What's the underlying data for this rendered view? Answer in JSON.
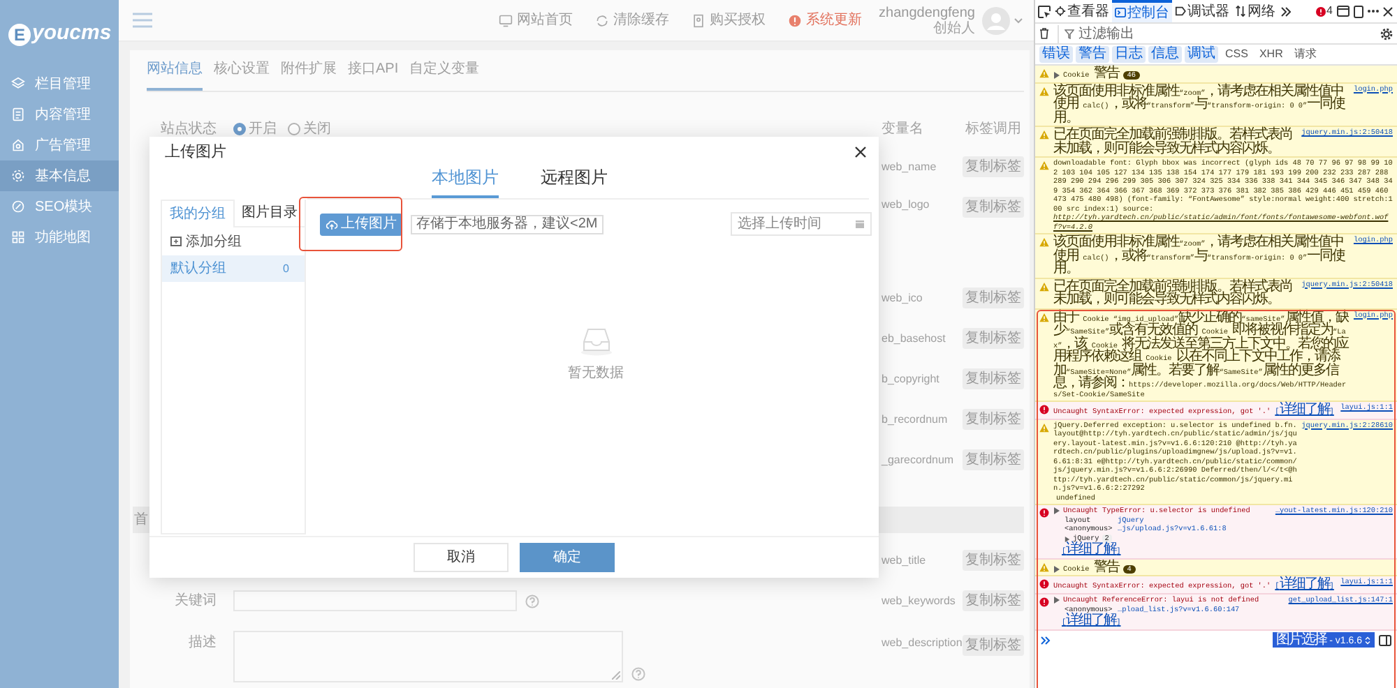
{
  "sidebar": {
    "logo_mark": "E",
    "logo_text": "youcms",
    "items": [
      {
        "label": "栏目管理",
        "selected": false
      },
      {
        "label": "内容管理",
        "selected": false
      },
      {
        "label": "广告管理",
        "selected": false
      },
      {
        "label": "基本信息",
        "selected": true
      },
      {
        "label": "SEO模块",
        "selected": false
      },
      {
        "label": "功能地图",
        "selected": false
      }
    ]
  },
  "header": {
    "links": [
      {
        "label": "网站首页",
        "alert": false
      },
      {
        "label": "清除缓存",
        "alert": false
      },
      {
        "label": "购买授权",
        "alert": false
      },
      {
        "label": "系统更新",
        "alert": true
      }
    ],
    "user": {
      "name": "zhangdengfeng",
      "role": "创始人"
    }
  },
  "tabs": [
    {
      "label": "网站信息",
      "selected": true
    },
    {
      "label": "核心设置",
      "selected": false
    },
    {
      "label": "附件扩展",
      "selected": false
    },
    {
      "label": "接口API",
      "selected": false
    },
    {
      "label": "自定义变量",
      "selected": false
    }
  ],
  "settings": {
    "status_label": "站点状态",
    "status_options": [
      {
        "label": "开启",
        "selected": true
      },
      {
        "label": "关闭",
        "selected": false
      }
    ],
    "columns": [
      "变量名",
      "标签调用"
    ],
    "rows": [
      {
        "kind": "text",
        "variable": "web_name",
        "action": "复制标签"
      },
      {
        "kind": "image",
        "variable": "web_logo",
        "action": "复制标签"
      },
      {
        "kind": "text",
        "variable": "web_ico",
        "action": "复制标签"
      },
      {
        "kind": "text",
        "variable": "eb_basehost",
        "action": "复制标签"
      },
      {
        "kind": "text",
        "variable": "b_copyright",
        "action": "复制标签"
      },
      {
        "kind": "text",
        "variable": "b_recordnum",
        "action": "复制标签"
      },
      {
        "kind": "text",
        "variable": "_garecordnum",
        "action": "复制标签"
      },
      {
        "kind": "section",
        "label": "首"
      },
      {
        "kind": "text",
        "variable": "web_title",
        "action": "复制标签"
      },
      {
        "kind": "input",
        "label": "关键词",
        "variable": "web_keywords",
        "action": "复制标签"
      },
      {
        "kind": "textarea",
        "label": "描述",
        "variable": "web_description",
        "action": "复制标签"
      }
    ]
  },
  "dialog": {
    "title": "上传图片",
    "tabs": [
      {
        "label": "本地图片",
        "selected": true
      },
      {
        "label": "远程图片",
        "selected": false
      }
    ],
    "group_tabs": [
      {
        "label": "我的分组",
        "selected": true
      },
      {
        "label": "图片目录",
        "selected": false
      }
    ],
    "add_group": "添加分组",
    "groups": [
      {
        "name": "默认分组",
        "count": "0",
        "selected": true
      }
    ],
    "upload_button": "上传图片",
    "upload_hint": "存储于本地服务器，建议<2M",
    "date_placeholder": "选择上传时间",
    "empty_text": "暂无数据",
    "buttons": [
      {
        "label": "取消",
        "primary": false
      },
      {
        "label": "确定",
        "primary": true
      }
    ]
  },
  "devtools": {
    "tabs": [
      {
        "label": "查看器",
        "selected": false
      },
      {
        "label": "控制台",
        "selected": true
      },
      {
        "label": "调试器",
        "selected": false
      },
      {
        "label": "网络",
        "selected": false
      }
    ],
    "error_count": "4",
    "filter_placeholder": "过滤输出",
    "filters": [
      {
        "label": "错误",
        "on": true
      },
      {
        "label": "警告",
        "on": true
      },
      {
        "label": "日志",
        "on": true
      },
      {
        "label": "信息",
        "on": true
      },
      {
        "label": "调试",
        "on": true
      },
      {
        "label": "CSS",
        "on": false
      },
      {
        "label": "XHR",
        "on": false
      },
      {
        "label": "请求",
        "on": false
      }
    ],
    "messages": [
      {
        "kind": "warning",
        "expandable": true,
        "text": "Cookie 警告",
        "count": "46"
      },
      {
        "kind": "warning",
        "expandable": false,
        "text": "该页面使用非标准属性“zoom”，请考虑在相关属性值中使用 calc()，或将“transform”与“transform-origin: 0 0”一同使用。",
        "source": "login.php"
      },
      {
        "kind": "warning",
        "expandable": false,
        "text": "已在页面完全加载前强制排版。若样式表尚未加载，则可能会导致无样式内容闪烁。",
        "source": "jquery.min.js:2:50418"
      },
      {
        "kind": "warning",
        "expandable": false,
        "text": "downloadable font: Glyph bbox was incorrect (glyph ids 48 70 77 96 97 98 99 102 103 104 105 127 134 135 138 154 174 177 179 181 193 199 200 232 233 287 288 289 290 294 296 299 305 306 307 324 325 334 336 338 341 344 345 346 347 348 349 354 362 364 366 367 368 369 372 373 376 381 382 385 386 429 446 451 459 460 473 475 480 498) (font-family: “FontAwesome” style:normal weight:400 stretch:100 src index:1) source:",
        "url": "http://tyh.yardtech.cn/public/static/admin/font/fonts/fontawesome-webfont.woff?v=4.2.0"
      },
      {
        "kind": "warning",
        "expandable": false,
        "text": "该页面使用非标准属性“zoom”，请考虑在相关属性值中使用 calc()，或将“transform”与“transform-origin: 0 0”一同使用。",
        "source": "login.php"
      },
      {
        "kind": "warning",
        "expandable": false,
        "text": "已在页面完全加载前强制排版。若样式表尚未加载，则可能会导致无样式内容闪烁。",
        "source": "jquery.min.js:2:50418"
      },
      {
        "kind": "warning",
        "expandable": false,
        "text": "由于 Cookie “img_id_upload”缺少正确的“sameSite”属性值，缺少“SameSite”或含有无效值的 Cookie 即将被视作指定为“Lax”，该 Cookie 将无法发送至第三方上下文中。若您的应用程序依赖这组 Cookie 以在不同上下文中工作，请添加“SameSite=None”属性。若要了解“SameSite”属性的更多信息，请参阅：https://developer.mozilla.org/docs/Web/HTTP/Headers/Set-Cookie/SameSite",
        "source": "login.php"
      },
      {
        "kind": "error",
        "expandable": false,
        "text": "Uncaught SyntaxError: expected expression, got '.'",
        "learn_more": "[详细了解]",
        "source": "layui.js:1:1"
      },
      {
        "kind": "warning",
        "expandable": false,
        "text": "jQuery.Deferred exception: u.selector is undefined b.fn.layout@http://tyh.yardtech.cn/public/static/admin/js/jquery.layout-latest.min.js?v=v1.6.6:120:210 @http://tyh.yardtech.cn/public/plugins/uploadimgnew/js/upload.js?v=v1.6.61:8:31 e@http://tyh.yardtech.cn/public/static/common/js/jquery.min.js?v=v1.6.6:2:26990 Deferred/then/l/</t<@http://tyh.yardtech.cn/public/static/common/js/jquery.min.js?v=v1.6.6:2:27292",
        "detail": "undefined",
        "source": "jquery.min.js:2:28610"
      },
      {
        "kind": "error",
        "expandable": true,
        "text": "Uncaught TypeError: u.selector is undefined",
        "source": "…yout-latest.min.js:120:210",
        "stack": [
          {
            "kind": "frame",
            "name": "layout",
            "location": "jQuery"
          },
          {
            "kind": "frame",
            "name": "<anonymous>",
            "location": "…js/upload.js?v=v1.6.61:8"
          },
          {
            "kind": "group",
            "name": "jQuery",
            "count": "2"
          }
        ],
        "learn_more": "[详细了解]"
      },
      {
        "kind": "warning",
        "expandable": true,
        "text": "Cookie 警告",
        "count": "4"
      },
      {
        "kind": "error",
        "expandable": false,
        "text": "Uncaught SyntaxError: expected expression, got '.'",
        "learn_more": "[详细了解]",
        "source": "layui.js:1:1"
      },
      {
        "kind": "error",
        "expandable": true,
        "text": "Uncaught ReferenceError: layui is not defined",
        "source": "get_upload_list.js:147:1",
        "stack": [
          {
            "kind": "frame",
            "name": "<anonymous>",
            "location": "…pload_list.js?v=v1.6.60:147"
          }
        ],
        "learn_more": "[详细了解]"
      }
    ],
    "context": "图片选择 - v1.6.6"
  }
}
